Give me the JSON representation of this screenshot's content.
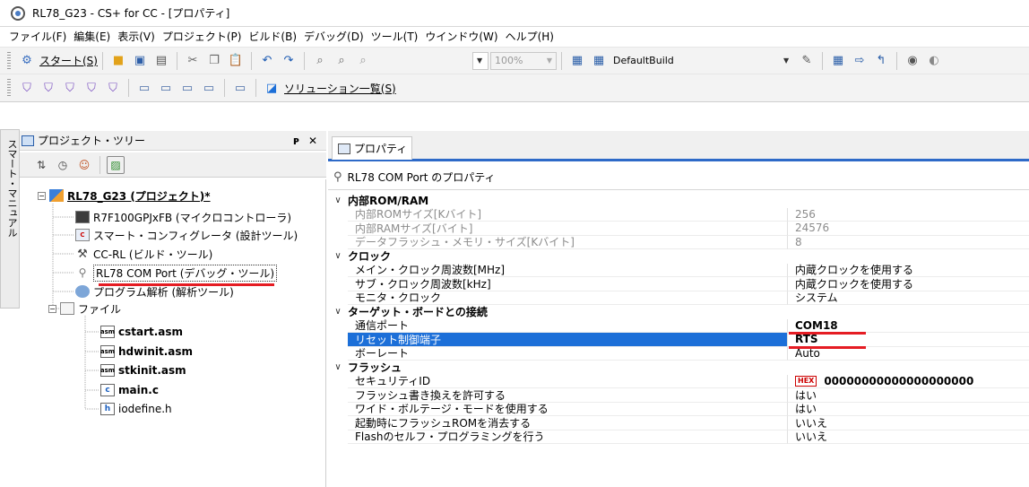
{
  "window": {
    "title": "RL78_G23 - CS+ for CC - [プロパティ]"
  },
  "menubar": {
    "items": [
      "ファイル(F)",
      "編集(E)",
      "表示(V)",
      "プロジェクト(P)",
      "ビルド(B)",
      "デバッグ(D)",
      "ツール(T)",
      "ウインドウ(W)",
      "ヘルプ(H)"
    ]
  },
  "toolbar1": {
    "start_label": "スタート(S)",
    "zoom_value": "100%",
    "build_config": "DefaultBuild"
  },
  "toolbar2": {
    "solution_list_label": "ソリューション一覧(S)"
  },
  "side_tab": {
    "label": "スマート・マニュアル"
  },
  "project_tree": {
    "title": "プロジェクト・ツリー",
    "pin": "ᴘ",
    "close": "✕",
    "nodes": [
      {
        "label": "RL78_G23 (プロジェクト)*"
      },
      {
        "label": "R7F100GPJxFB (マイクロコントローラ)"
      },
      {
        "label": "スマート・コンフィグレータ (設計ツール)"
      },
      {
        "label": "CC-RL (ビルド・ツール)"
      },
      {
        "label": "RL78 COM Port (デバッグ・ツール)"
      },
      {
        "label": "プログラム解析 (解析ツール)"
      },
      {
        "label": "ファイル"
      },
      {
        "label": "cstart.asm"
      },
      {
        "label": "hdwinit.asm"
      },
      {
        "label": "stkinit.asm"
      },
      {
        "label": "main.c"
      },
      {
        "label": "iodefine.h"
      }
    ]
  },
  "properties": {
    "tab_label": "プロパティ",
    "header": "RL78 COM Port のプロパティ",
    "rows": [
      {
        "kind": "category",
        "name": "内部ROM/RAM",
        "value": ""
      },
      {
        "kind": "prop",
        "name": "内部ROMサイズ[Kバイト]",
        "value": "256",
        "disabled": true
      },
      {
        "kind": "prop",
        "name": "内部RAMサイズ[バイト]",
        "value": "24576",
        "disabled": true
      },
      {
        "kind": "prop",
        "name": "データフラッシュ・メモリ・サイズ[Kバイト]",
        "value": "8",
        "disabled": true
      },
      {
        "kind": "category",
        "name": "クロック",
        "value": ""
      },
      {
        "kind": "prop",
        "name": "メイン・クロック周波数[MHz]",
        "value": "内蔵クロックを使用する"
      },
      {
        "kind": "prop",
        "name": "サブ・クロック周波数[kHz]",
        "value": "内蔵クロックを使用する"
      },
      {
        "kind": "prop",
        "name": "モニタ・クロック",
        "value": "システム"
      },
      {
        "kind": "category",
        "name": "ターゲット・ボードとの接続",
        "value": ""
      },
      {
        "kind": "prop",
        "name": "通信ポート",
        "value": "COM18",
        "bold": true
      },
      {
        "kind": "prop",
        "name": "リセット制御端子",
        "value": "RTS",
        "bold": true,
        "highlight": true
      },
      {
        "kind": "prop",
        "name": "ボーレート",
        "value": "Auto"
      },
      {
        "kind": "category",
        "name": "フラッシュ",
        "value": ""
      },
      {
        "kind": "prop",
        "name": "セキュリティID",
        "value": "00000000000000000000",
        "bold": true,
        "hex": "HEX"
      },
      {
        "kind": "prop",
        "name": "フラッシュ書き換えを許可する",
        "value": "はい"
      },
      {
        "kind": "prop",
        "name": "ワイド・ボルテージ・モードを使用する",
        "value": "はい"
      },
      {
        "kind": "prop",
        "name": "起動時にフラッシュROMを消去する",
        "value": "いいえ"
      },
      {
        "kind": "prop",
        "name": "Flashのセルフ・プログラミングを行う",
        "value": "いいえ"
      }
    ]
  },
  "colors": {
    "accent_blue": "#1c6fd8",
    "annotation_red": "#e51c23"
  }
}
